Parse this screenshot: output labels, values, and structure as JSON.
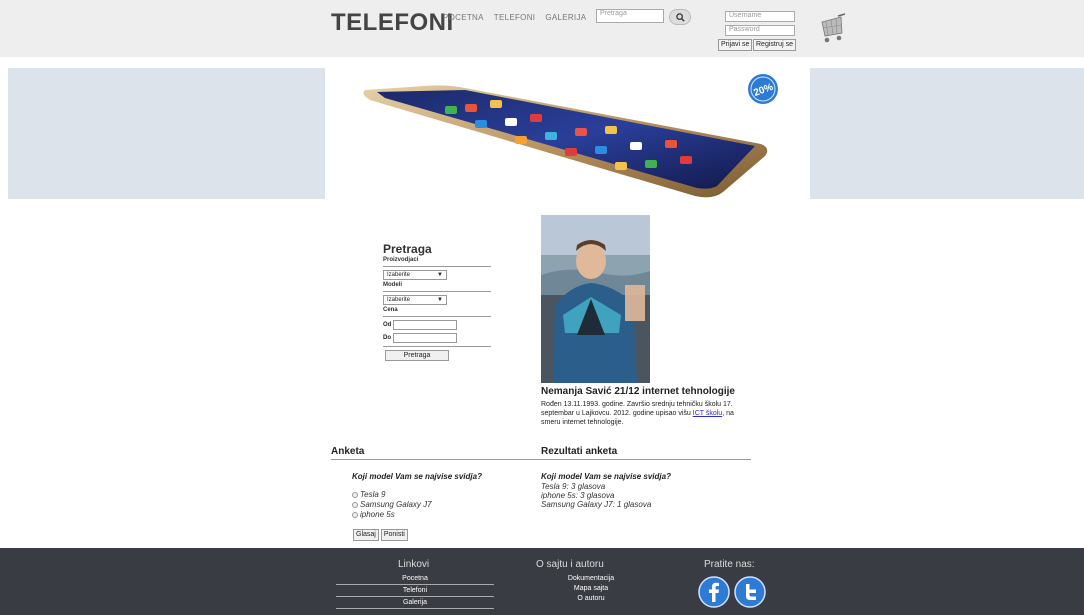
{
  "header": {
    "logo": "TELEFONI",
    "nav": [
      "POCETNA",
      "TELEFONI",
      "GALERIJA"
    ],
    "search_placeholder": "Pretraga",
    "username_placeholder": "Username",
    "password_placeholder": "Password",
    "login_label": "Prijavi se",
    "register_label": "Registruj se",
    "cart_icon": "shopping-cart-icon"
  },
  "banner": {
    "badge_text": "20%",
    "image": "smartphone-banner"
  },
  "search_panel": {
    "title": "Pretraga",
    "manufacturers_label": "Proizvodjaci",
    "manufacturers_value": "Izaberite",
    "models_label": "Modeli",
    "models_value": "Izaberite",
    "price_label": "Cena",
    "from_label": "Od",
    "to_label": "Do",
    "submit_label": "Pretraga"
  },
  "author": {
    "name": "Nemanja Savić 21/12 internet tehnologije",
    "bio_before": "Rođen 13.11.1993. godine. Završio srednju tehničku školu 17. septembar u Lajkovcu. 2012. godine upisao višu ",
    "bio_link": "ICT školu",
    "bio_after": ", na smeru internet tehnologije."
  },
  "survey": {
    "title": "Anketa",
    "question": "Koji model Vam se najvise svidja?",
    "options": [
      "Tesla 9",
      "Samsung Galaxy J7",
      "iphone 5s"
    ],
    "vote_label": "Glasaj",
    "reset_label": "Ponisti"
  },
  "results": {
    "title": "Rezultati anketa",
    "question": "Koji model Vam se najvise svidja?",
    "lines": [
      "Tesla 9: 3 glasova",
      "iphone 5s: 3 glasova",
      "Samsung Galaxy J7: 1 glasova"
    ]
  },
  "footer": {
    "links_title": "Linkovi",
    "links": [
      "Pocetna",
      "Telefoni",
      "Galerija"
    ],
    "about_title": "O sajtu i autoru",
    "about_links": [
      "Dokumentacija",
      "Mapa sajta",
      "O autoru"
    ],
    "follow_title": "Pratite nas:",
    "social_icons": [
      "facebook-icon",
      "twitter-icon"
    ]
  },
  "colors": {
    "header_bg": "#eeeeee",
    "banner_side": "#dce3ea",
    "footer_bg": "#3a3c44",
    "social_blue": "#2e7bd6"
  }
}
